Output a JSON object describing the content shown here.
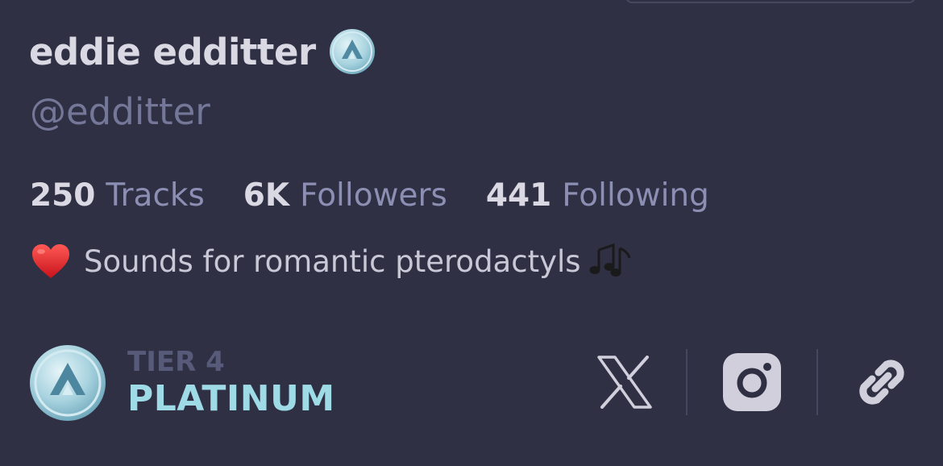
{
  "profile": {
    "display_name": "eddie edditter",
    "handle": "@edditter",
    "verified_icon": "audius-verified-badge-icon"
  },
  "stats": [
    {
      "count": "250",
      "label": "Tracks"
    },
    {
      "count": "6K",
      "label": "Followers"
    },
    {
      "count": "441",
      "label": "Following"
    }
  ],
  "bio": {
    "text": "Sounds for romantic pterodactyls",
    "leading_emoji": "heart-icon",
    "trailing_emoji": "musical-notes-icon"
  },
  "tier": {
    "level": "TIER 4",
    "name": "PLATINUM",
    "icon": "platinum-tier-badge-icon",
    "color": "#9edbe6"
  },
  "social": [
    {
      "name": "x-icon"
    },
    {
      "name": "instagram-icon"
    },
    {
      "name": "link-icon"
    }
  ],
  "colors": {
    "background": "#2f3044",
    "primary_text": "#d9d8e3",
    "secondary_text": "#8c8fb3",
    "tier_accent": "#9edbe6"
  }
}
